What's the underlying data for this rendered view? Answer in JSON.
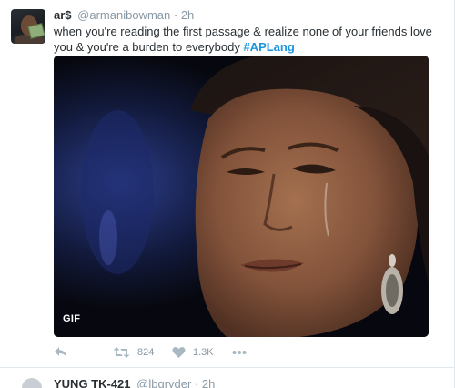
{
  "tweet": {
    "name": "ar$",
    "handle": "@armanibowman",
    "separator": "·",
    "time": "2h",
    "text_plain": "when you're reading the first passage & realize none of your friends love you & you're a burden to everybody ",
    "hashtag": "#APLang",
    "media_badge": "GIF",
    "actions": {
      "reply_icon": "reply-icon",
      "retweet_icon": "retweet-icon",
      "retweet_count": "824",
      "like_icon": "heart-icon",
      "like_count": "1.3K",
      "more_icon": "more-icon"
    }
  },
  "next_tweet": {
    "name": "YUNG TK-421",
    "handle": "@lbgryder",
    "separator": "·",
    "time": "2h"
  },
  "colors": {
    "text": "#292f33",
    "muted": "#8899a6",
    "hashtag": "#1b95e0",
    "action_icon": "#aab8c2",
    "divider": "#e1e8ed"
  }
}
